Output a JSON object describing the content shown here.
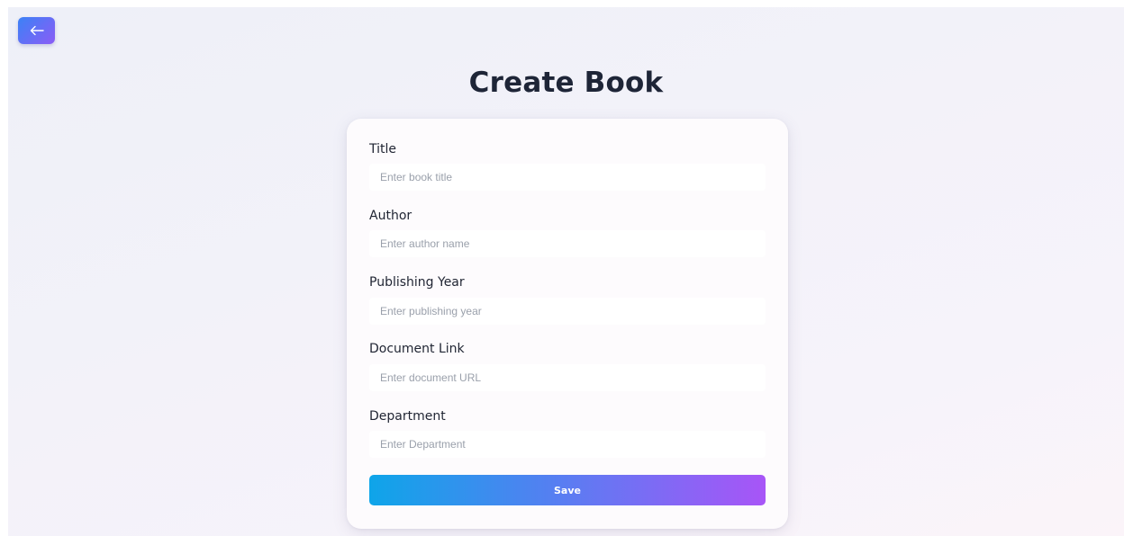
{
  "header": {
    "back_icon": "arrow-left-icon",
    "title": "Create Book"
  },
  "form": {
    "fields": [
      {
        "label": "Title",
        "placeholder": "Enter book title",
        "value": ""
      },
      {
        "label": "Author",
        "placeholder": "Enter author name",
        "value": ""
      },
      {
        "label": "Publishing Year",
        "placeholder": "Enter publishing year",
        "value": ""
      },
      {
        "label": "Document Link",
        "placeholder": "Enter document URL",
        "value": ""
      },
      {
        "label": "Department",
        "placeholder": "Enter Department",
        "value": ""
      }
    ],
    "save_label": "Save"
  },
  "colors": {
    "back_button_gradient": [
      "#3b82f6",
      "#8b5cf6"
    ],
    "save_button_gradient": [
      "#0ea5e9",
      "#5b7cf2",
      "#a855f7"
    ],
    "title_text": "#1e2537"
  }
}
